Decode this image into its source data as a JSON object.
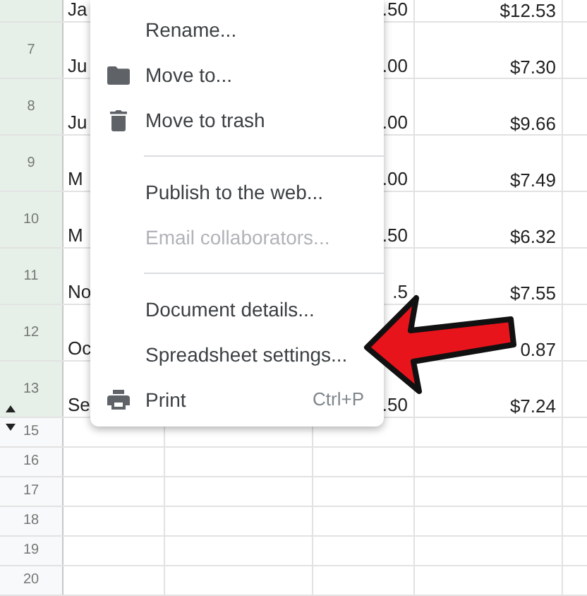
{
  "rows": [
    {
      "number": "",
      "kind": "partial",
      "selected": true,
      "col_a": "Ja",
      "col_c": ".50",
      "col_d": "$12.53"
    },
    {
      "number": "7",
      "kind": "tall",
      "selected": true,
      "col_a": "Ju",
      "col_c": ".00",
      "col_d": "$7.30"
    },
    {
      "number": "8",
      "kind": "tall",
      "selected": true,
      "col_a": "Ju",
      "col_c": ".00",
      "col_d": "$9.66"
    },
    {
      "number": "9",
      "kind": "tall",
      "selected": true,
      "col_a": "M",
      "col_c": ".00",
      "col_d": "$7.49"
    },
    {
      "number": "10",
      "kind": "tall",
      "selected": true,
      "col_a": "M",
      "col_c": ".50",
      "col_d": "$6.32"
    },
    {
      "number": "11",
      "kind": "tall",
      "selected": true,
      "col_a": "No",
      "col_c": ".5",
      "col_d": "$7.55"
    },
    {
      "number": "12",
      "kind": "tall",
      "selected": true,
      "col_a": "Oc",
      "col_c": "",
      "col_d": "0.87"
    },
    {
      "number": "13",
      "kind": "beforehidden",
      "selected": true,
      "col_a": "Se",
      "col_c": ".50",
      "col_d": "$7.24"
    },
    {
      "number": "15",
      "kind": "afterhidden",
      "selected": false,
      "col_a": "",
      "col_c": "",
      "col_d": ""
    },
    {
      "number": "16",
      "kind": "short",
      "selected": false,
      "col_a": "",
      "col_c": "",
      "col_d": ""
    },
    {
      "number": "17",
      "kind": "short",
      "selected": false,
      "col_a": "",
      "col_c": "",
      "col_d": ""
    },
    {
      "number": "18",
      "kind": "short",
      "selected": false,
      "col_a": "",
      "col_c": "",
      "col_d": ""
    },
    {
      "number": "19",
      "kind": "short",
      "selected": false,
      "col_a": "",
      "col_c": "",
      "col_d": ""
    },
    {
      "number": "20",
      "kind": "short",
      "selected": false,
      "col_a": "",
      "col_c": "",
      "col_d": ""
    }
  ],
  "menu": {
    "items": [
      {
        "kind": "item",
        "label": "Rename...",
        "disabled": false
      },
      {
        "kind": "folder",
        "label": "Move to...",
        "disabled": false
      },
      {
        "kind": "trash",
        "label": "Move to trash",
        "disabled": false
      },
      {
        "kind": "divider"
      },
      {
        "kind": "item",
        "label": "Publish to the web...",
        "disabled": false
      },
      {
        "kind": "item",
        "label": "Email collaborators...",
        "disabled": true
      },
      {
        "kind": "divider"
      },
      {
        "kind": "item",
        "label": "Document details...",
        "disabled": false
      },
      {
        "kind": "item",
        "label": "Spreadsheet settings...",
        "disabled": false
      },
      {
        "kind": "print",
        "label": "Print",
        "disabled": false,
        "shortcut": "Ctrl+P"
      }
    ]
  }
}
